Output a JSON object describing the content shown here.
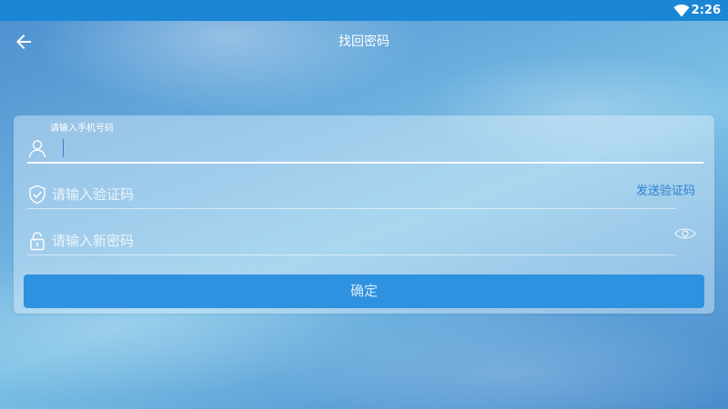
{
  "status_bar": {
    "time": "2:26",
    "icons": [
      "wifi-icon"
    ],
    "background": "#1b86d6"
  },
  "app_bar": {
    "title": "找回密码",
    "back_icon": "arrow-left-icon"
  },
  "form": {
    "phone": {
      "floating_label": "请输入手机号码",
      "value": "",
      "placeholder": "",
      "icon": "user-icon"
    },
    "code": {
      "value": "",
      "placeholder": "请输入验证码",
      "icon": "shield-check-icon",
      "send_code_label": "发送验证码"
    },
    "password": {
      "value": "",
      "placeholder": "请输入新密码",
      "icon": "lock-icon",
      "toggle_icon": "eye-icon"
    },
    "confirm_label": "确定"
  },
  "colors": {
    "accent": "#2e92e0",
    "link": "#2b7fd0",
    "text_on_bg": "#ffffff"
  }
}
